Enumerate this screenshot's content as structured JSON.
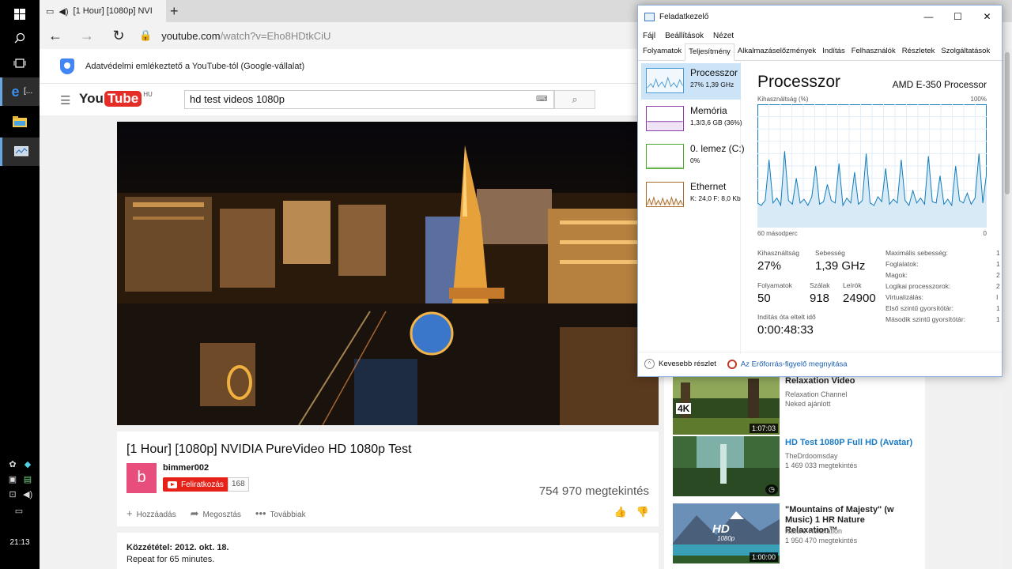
{
  "taskbar": {
    "edge_label": "[...",
    "clock": "21:13"
  },
  "browser": {
    "tab_title": "[1 Hour] [1080p] NVI",
    "new_tab": "+",
    "url_host": "youtube.com",
    "url_path": "/watch?v=Eho8HDtkCiU"
  },
  "youtube": {
    "privacy_notice": "Adatvédelmi emlékeztető a YouTube-tól (Google-vállalat)",
    "logo_you": "You",
    "logo_tube": "Tube",
    "logo_region": "HU",
    "search_value": "hd test videos 1080p",
    "video": {
      "title": "[1 Hour] [1080p] NVIDIA PureVideo HD 1080p Test",
      "avatar_letter": "b",
      "channel": "bimmer002",
      "subscribe_label": "Feliratkozás",
      "sub_count": "168",
      "views": "754 970 megtekintés",
      "add_label": "Hozzáadás",
      "share_label": "Megosztás",
      "more_label": "Továbbiak",
      "published": "Közzététel: 2012. okt. 18.",
      "description": "Repeat for 65 minutes."
    },
    "related": [
      {
        "title": "Relaxation Video",
        "channel": "Relaxation Channel",
        "meta": "Neked ajánlott",
        "duration": "1:07:03",
        "badge": "4K",
        "link": false
      },
      {
        "title": "HD Test 1080P Full HD (Avatar)",
        "channel": "TheDrdoomsday",
        "meta": "1 469 033 megtekintés",
        "duration": "",
        "badge": "",
        "link": true
      },
      {
        "title": "\"Mountains of Majesty\" (w Music) 1 HR Nature Relaxation™",
        "channel": "Nature Relaxation",
        "meta": "1 950 470 megtekintés",
        "duration": "1:00:00",
        "badge": "HD",
        "badge_sub": "1080p",
        "link": false
      }
    ]
  },
  "taskmanager": {
    "title": "Feladatkezelő",
    "menu": [
      "Fájl",
      "Beállítások",
      "Nézet"
    ],
    "tabs": [
      "Folyamatok",
      "Teljesítmény",
      "Alkalmazáselőzmények",
      "Indítás",
      "Felhasználók",
      "Részletek",
      "Szolgáltatások"
    ],
    "active_tab": 1,
    "resources": [
      {
        "name": "Processzor",
        "value": "27% 1,39 GHz",
        "color": "#4a9ad4"
      },
      {
        "name": "Memória",
        "value": "1,3/3,6 GB (36%)",
        "color": "#8b3fa8"
      },
      {
        "name": "0. lemez (C:)",
        "value": "0%",
        "color": "#4ea72e"
      },
      {
        "name": "Ethernet",
        "value": "K: 24,0 F: 8,0 Kb",
        "color": "#a76d2b"
      }
    ],
    "heading": "Processzor",
    "cpu_name": "AMD E-350 Processor",
    "graph_label": "Kihasználtság (%)",
    "graph_max": "100%",
    "graph_time": "60 másodperc",
    "graph_zero": "0",
    "stats": {
      "util_label": "Kihasználtság",
      "util_value": "27%",
      "speed_label": "Sebesség",
      "speed_value": "1,39 GHz",
      "proc_label": "Folyamatok",
      "proc_value": "50",
      "threads_label": "Szálak",
      "threads_value": "918",
      "handles_label": "Leírók",
      "handles_value": "24900",
      "uptime_label": "Indítás óta eltelt idő",
      "uptime_value": "0:00:48:33"
    },
    "details": [
      {
        "k": "Maximális sebesség:",
        "v": "1"
      },
      {
        "k": "Foglalatok:",
        "v": "1"
      },
      {
        "k": "Magok:",
        "v": "2"
      },
      {
        "k": "Logikai processzorok:",
        "v": "2"
      },
      {
        "k": "Virtualizálás:",
        "v": "I"
      },
      {
        "k": "Első szintű gyorsítótár:",
        "v": "1"
      },
      {
        "k": "Második szintű gyorsítótár:",
        "v": "1"
      }
    ],
    "fewer_details": "Kevesebb részlet",
    "resource_monitor": "Az Erőforrás-figyelő megnyitása"
  },
  "cpu_graph": {
    "type": "line",
    "ylim": [
      0,
      100
    ],
    "values": [
      20,
      18,
      22,
      55,
      20,
      24,
      18,
      62,
      22,
      19,
      40,
      20,
      23,
      18,
      25,
      50,
      19,
      21,
      35,
      22,
      20,
      52,
      18,
      24,
      20,
      45,
      19,
      22,
      60,
      20,
      18,
      25,
      21,
      48,
      19,
      23,
      20,
      55,
      22,
      18,
      30,
      20,
      24,
      19,
      58,
      21,
      20,
      42,
      19,
      23,
      18,
      50,
      22,
      20,
      28,
      19,
      24,
      60,
      20,
      45
    ]
  },
  "colors": {
    "accent": "#167ac6",
    "youtube_red": "#e62117",
    "cpu_line": "#117dbb"
  }
}
